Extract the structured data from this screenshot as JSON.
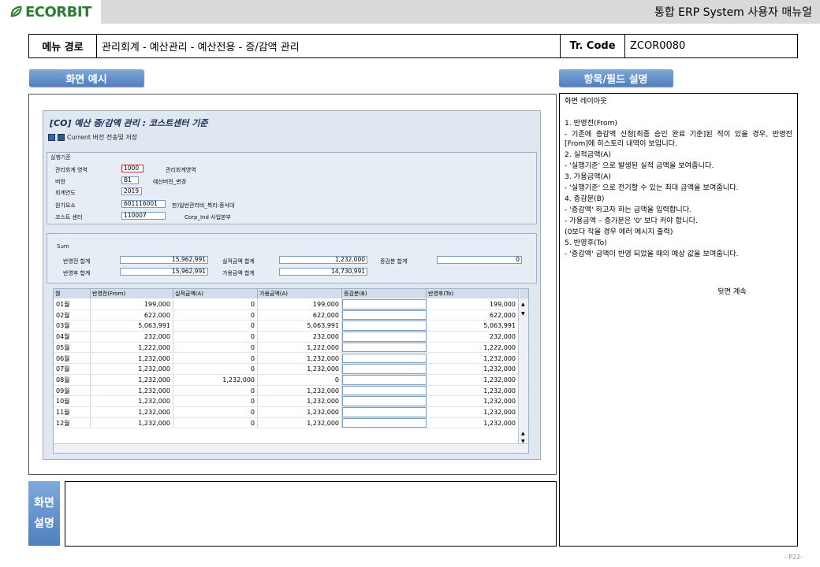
{
  "header": {
    "logo": "ECORBIT",
    "manual_title": "통합 ERP System 사용자 매뉴얼"
  },
  "menu": {
    "path_label": "메뉴 경로",
    "path_value": "관리회계 - 예산관리 - 예산전용 - 증/감액 관리",
    "tr_label": "Tr. Code",
    "tr_value": "ZCOR0080"
  },
  "sections": {
    "screen_example": "화면 예시",
    "field_desc": "항목/필드 설명",
    "screen_desc_1": "화면",
    "screen_desc_2": "설명"
  },
  "sap": {
    "title": "[CO] 예산 증/감액 관리 : 코스트센터 기준",
    "toolbar_text": "Current 버전 전송및 저장",
    "criteria_group": "실행기준",
    "fields": [
      {
        "label": "관리회계 영역",
        "value": "1000",
        "desc": "관리회계영역"
      },
      {
        "label": "버전",
        "value": "B1",
        "desc": "예산버전_변경"
      },
      {
        "label": "회계연도",
        "value": "2019",
        "desc": ""
      },
      {
        "label": "원가요소",
        "value": "601116001",
        "desc": "판)일반관리비_복리:중식대"
      },
      {
        "label": "코스트 센터",
        "value": "110007",
        "desc": "Corp_Ind 사업본부"
      }
    ],
    "sum_group": "Sum",
    "sum": {
      "before_label": "반영전 합계",
      "before_value": "15,962,991",
      "actual_label": "실적금액 합계",
      "actual_value": "1,232,000",
      "change_label": "증감분 합계",
      "change_value": "0",
      "after_label": "반영후 합계",
      "after_value": "15,962,991",
      "avail_label": "가용금액 합계",
      "avail_value": "14,730,991"
    },
    "table": {
      "columns": [
        "월",
        "반영전(From)",
        "실적금액(A)",
        "가용금액(A)",
        "증감분(B)",
        "반영후(To)"
      ],
      "rows": [
        [
          "01월",
          "199,000",
          "0",
          "199,000",
          "",
          "199,000"
        ],
        [
          "02월",
          "622,000",
          "0",
          "622,000",
          "",
          "622,000"
        ],
        [
          "03월",
          "5,063,991",
          "0",
          "5,063,991",
          "",
          "5,063,991"
        ],
        [
          "04월",
          "232,000",
          "0",
          "232,000",
          "",
          "232,000"
        ],
        [
          "05월",
          "1,222,000",
          "0",
          "1,222,000",
          "",
          "1,222,000"
        ],
        [
          "06월",
          "1,232,000",
          "0",
          "1,232,000",
          "",
          "1,232,000"
        ],
        [
          "07월",
          "1,232,000",
          "0",
          "1,232,000",
          "",
          "1,232,000"
        ],
        [
          "08월",
          "1,232,000",
          "1,232,000",
          "0",
          "",
          "1,232,000"
        ],
        [
          "09월",
          "1,232,000",
          "0",
          "1,232,000",
          "",
          "1,232,000"
        ],
        [
          "10월",
          "1,232,000",
          "0",
          "1,232,000",
          "",
          "1,232,000"
        ],
        [
          "11월",
          "1,232,000",
          "0",
          "1,232,000",
          "",
          "1,232,000"
        ],
        [
          "12월",
          "1,232,000",
          "0",
          "1,232,000",
          "",
          "1,232,000"
        ]
      ]
    }
  },
  "description": {
    "layout_title": "화면 레이아웃",
    "lines": [
      "1.    반영전(From)",
      "  - 기존에 증감액 신청[최종 승인 완료 기준]된 적이 있을 경우, 반영전[From]에 히스토리 내역이 보입니다.",
      "2.  실적금액(A)",
      "  - '실행기준' 으로 발생된 실적 금액을 보여줍니다.",
      "3.  가용금액(A)",
      "  - '실행기준' 으로 전기할 수 있는 최대 금액을 보여줍니다.",
      "4.  증감분(B)",
      "  - '증감액' 하고자 하는 금액을 입력합니다.",
      " - 가용금액 – 증가분은 '0' 보다 커야 합니다.",
      "   (0보다 작을 경우 에러 메시지 출력)",
      "5.  반영후(To)",
      "  - '증감액' 금액이 반영 되었을 때의 예상 값을 보여줍니다."
    ],
    "continued": "뒷면 계속"
  },
  "page_number": "- P22-"
}
